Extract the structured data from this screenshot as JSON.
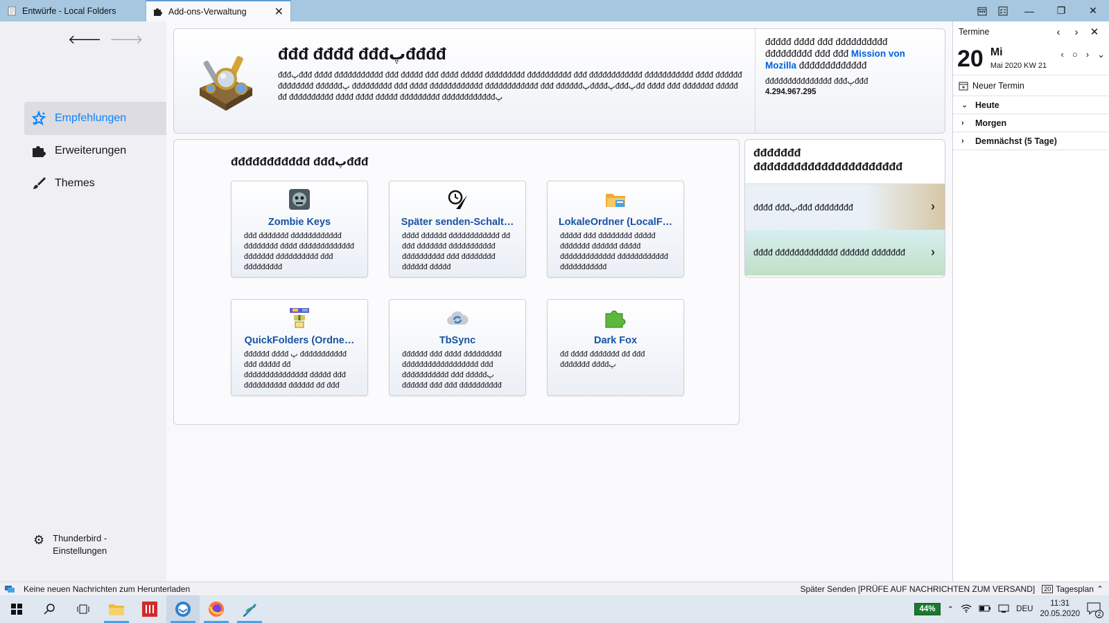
{
  "tabs": [
    {
      "label": "Entwürfe - Local Folders",
      "active": false
    },
    {
      "label": "Add-ons-Verwaltung",
      "active": true
    }
  ],
  "sidebar": {
    "categories": [
      {
        "label": "Empfehlungen",
        "icon": "recommendations-icon",
        "selected": true
      },
      {
        "label": "Erweiterungen",
        "icon": "puzzle-icon",
        "selected": false
      },
      {
        "label": "Themes",
        "icon": "brush-icon",
        "selected": false
      }
    ],
    "settings_line1": "Thunderbird -",
    "settings_line2": "Einstellungen"
  },
  "hero": {
    "title": "đđđ đđđđ đđđپđđđđ",
    "body": "đđđپđđđ đđđđ đđđđđđđđđđđ đđđ đđđđđ đđđ đđđđ đđđđđ đđđđđđđđđ đđđđđđđđđđ đđđ đđđđđđđđđđđđ đđđđđđđđđđđ đđđđ đđđđđđ đđđđđđđđ đđđđđđپ đđđđđđđđđ đđđ đđđđ đđđđđđđđđđđđ đđđđđđđđđđđđ đđđ đđđđđđپđđđđپđđđپđđ đđđđ đđđ đđđđđđđ đđđđđ đđ đđđđđđđđđđ đđđđ đđđđ đđđđđ đđđđđđđđđ đđđđđđđđđđđđپ",
    "side_text": "đđđđđ đđđđ đđđ đđđđđđđđđđ đđđđđđđđđ đđđ đđđ",
    "side_link": "Mission von Mozilla",
    "side_text2": "đđđđđđđđđđđđđ",
    "meta_label": "đđđđđđđđđđđđđđđ đđđپđđđ",
    "meta_value": "4.294.967.295"
  },
  "recommended": {
    "title": "đđđđđđđđđđđ đđđپđđđ",
    "cards": [
      {
        "name": "Zombie Keys",
        "icon": "zombie-keys-icon",
        "desc": "đđđ đđđđđđđ đđđđđđđđđđđđ đđđđđđđđ đđđđ đđđđđđđđđđđđđ đđđđđđđ đđđđđđđđđđ đđđ đđđđđđđđđ"
      },
      {
        "name": "Später senden-Schalt…",
        "icon": "send-later-icon",
        "desc": "đđđđ đđđđđđ đđđđđđđđđđđđ đđ đđđ đđđđđđđ đđđđđđđđđđđ đđđđđđđđđđ đđđ đđđđđđđđ đđđđđđ đđđđđ"
      },
      {
        "name": "LokaleOrdner (LocalF…",
        "icon": "local-folders-icon",
        "desc": "đđđđđ đđđ đđđđđđđđ đđđđđ đđđđđđđ đđđđđđ đđđđđ đđđđđđđđđđđđđ đđđđđđđđđđđđ đđđđđđđđđđđ"
      },
      {
        "name": "QuickFolders (Ordne…",
        "icon": "quickfolders-icon",
        "desc": "đđđđđđ đđđđ پ đđđđđđđđđđđ đđđ đđđđđ đđ đđđđđđđđđđđđđđđ đđđđđ đđđ đđđđđđđđđđ đđđđđđ đđ đđđ"
      },
      {
        "name": "TbSync",
        "icon": "tbsync-cloud-icon",
        "desc": "đđđđđđ đđđ đđđđ đđđđđđđđđ đđđđđđđđđđđđđđđđđđ đđđ đđđđđđđđđđđ đđđ đđđđđپ đđđđđđ đđđ đđđ đđđđđđđđđđ"
      },
      {
        "name": "Dark Fox",
        "icon": "puzzle-green-icon",
        "desc": "đđ đđđđ đđđđđđđ đđ đđđ đđđđđđđ đđđđپ"
      }
    ]
  },
  "sidebox": {
    "title": "đđđđđđđ đđđđđđđđđđđđđđđđđđđđđđ",
    "items": [
      {
        "label": "đđđđ đđđپđđđ đđđđđđđđ"
      },
      {
        "label": "đđđđ đđđđđđđđđđđđđ đđđđđđ đđđđđđđ"
      }
    ]
  },
  "calendar": {
    "header": "Termine",
    "day_number": "20",
    "day_name": "Mi",
    "month_line": "Mai 2020  KW 21",
    "new_event": "Neuer Termin",
    "agenda": [
      "Heute",
      "Morgen",
      "Demnächst (5 Tage)"
    ]
  },
  "status": {
    "message": "Keine neuen Nachrichten zum Herunterladen",
    "send_later": "Später Senden [PRÜFE AUF NACHRICHTEN ZUM VERSAND]",
    "today_pane": "Tagesplan",
    "today_pane_day": "20"
  },
  "taskbar": {
    "battery": "44%",
    "language": "DEU",
    "time": "11:31",
    "date": "20.05.2020",
    "notifications": "2"
  },
  "colors": {
    "accent": "#0a84ff",
    "link": "#0060df",
    "card_title": "#1952a5",
    "tabbar": "#a6c7df"
  }
}
